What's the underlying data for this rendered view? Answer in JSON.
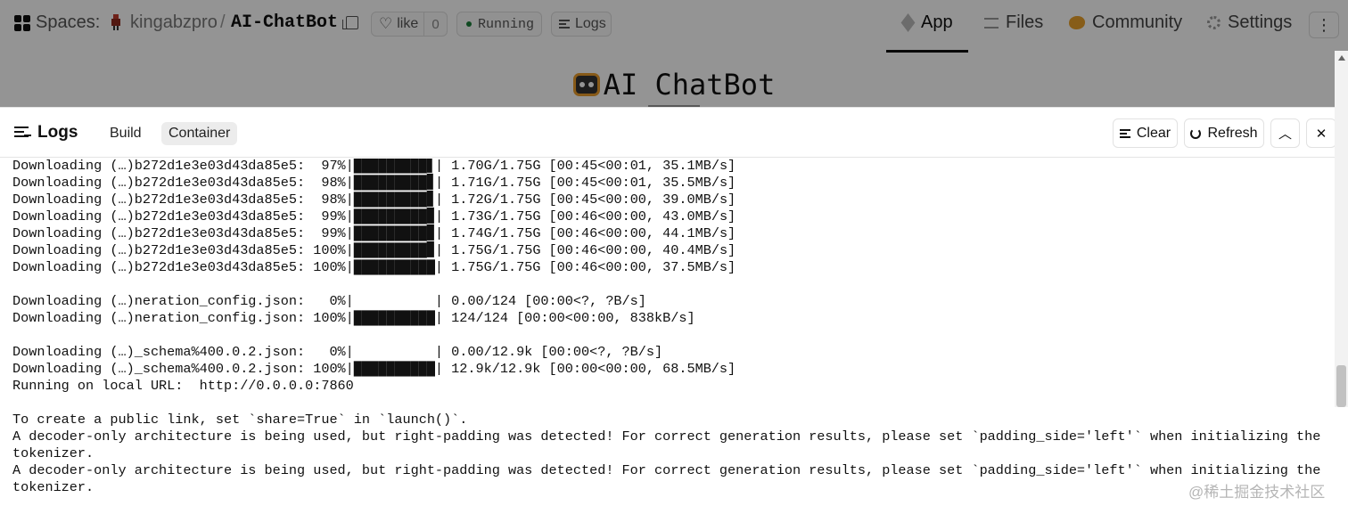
{
  "header": {
    "spaces_label": "Spaces:",
    "owner": "kingabzpro",
    "separator": "/",
    "space_name": "AI-ChatBot",
    "like_label": "like",
    "like_count": "0",
    "status": "Running",
    "logs_label": "Logs"
  },
  "nav": {
    "app": "App",
    "files": "Files",
    "community": "Community",
    "settings": "Settings"
  },
  "app": {
    "title": "AI ChatBot"
  },
  "logs_panel": {
    "title": "Logs",
    "tabs": [
      "Build",
      "Container"
    ],
    "active_tab": "Container",
    "clear_label": "Clear",
    "refresh_label": "Refresh",
    "lines": [
      "Downloading (…)b272d1e3e03d43da85e5:  97%|█████████▋| 1.70G/1.75G [00:45<00:01, 35.1MB/s]",
      "Downloading (…)b272d1e3e03d43da85e5:  98%|█████████▊| 1.71G/1.75G [00:45<00:01, 35.5MB/s]",
      "Downloading (…)b272d1e3e03d43da85e5:  98%|█████████▊| 1.72G/1.75G [00:45<00:00, 39.0MB/s]",
      "Downloading (…)b272d1e3e03d43da85e5:  99%|█████████▉| 1.73G/1.75G [00:46<00:00, 43.0MB/s]",
      "Downloading (…)b272d1e3e03d43da85e5:  99%|█████████▉| 1.74G/1.75G [00:46<00:00, 44.1MB/s]",
      "Downloading (…)b272d1e3e03d43da85e5: 100%|█████████▉| 1.75G/1.75G [00:46<00:00, 40.4MB/s]",
      "Downloading (…)b272d1e3e03d43da85e5: 100%|██████████| 1.75G/1.75G [00:46<00:00, 37.5MB/s]",
      "",
      "Downloading (…)neration_config.json:   0%|          | 0.00/124 [00:00<?, ?B/s]",
      "Downloading (…)neration_config.json: 100%|██████████| 124/124 [00:00<00:00, 838kB/s]",
      "",
      "Downloading (…)_schema%400.0.2.json:   0%|          | 0.00/12.9k [00:00<?, ?B/s]",
      "Downloading (…)_schema%400.0.2.json: 100%|██████████| 12.9k/12.9k [00:00<00:00, 68.5MB/s]",
      "Running on local URL:  http://0.0.0.0:7860",
      "",
      "To create a public link, set `share=True` in `launch()`.",
      "A decoder-only architecture is being used, but right-padding was detected! For correct generation results, please set `padding_side='left'` when initializing the",
      "tokenizer.",
      "A decoder-only architecture is being used, but right-padding was detected! For correct generation results, please set `padding_side='left'` when initializing the",
      "tokenizer."
    ]
  },
  "watermark": "@稀土掘金技术社区"
}
